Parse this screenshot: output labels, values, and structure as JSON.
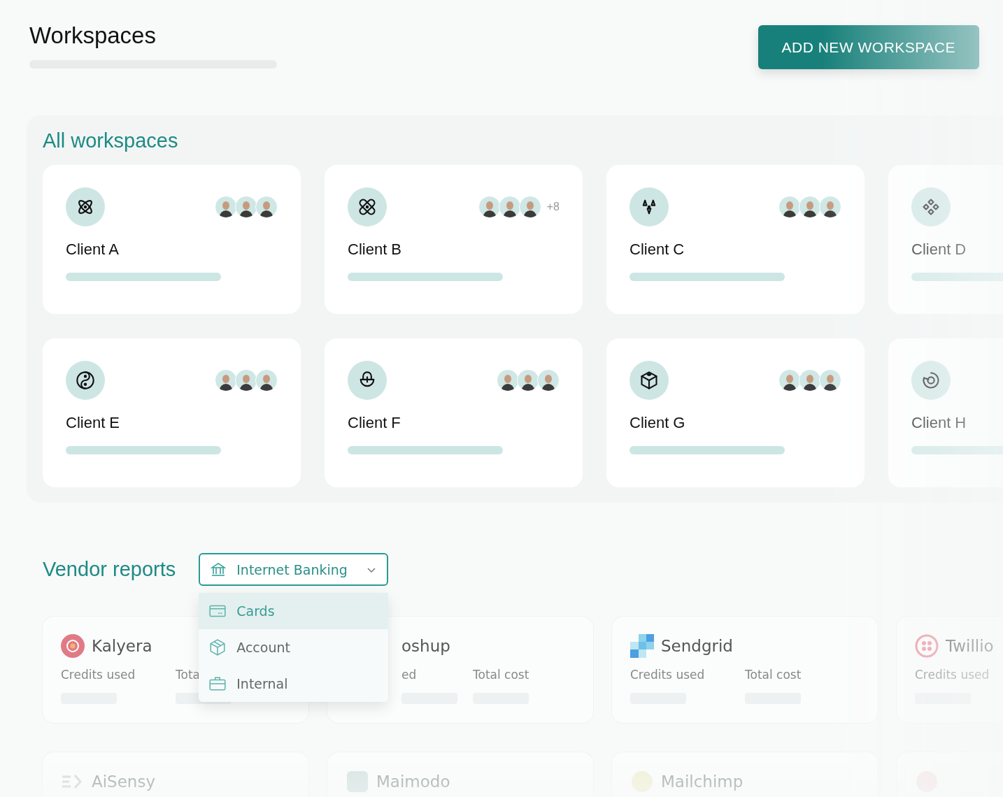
{
  "header": {
    "title": "Workspaces",
    "add_button": "ADD NEW WORKSPACE"
  },
  "workspaces": {
    "title": "All workspaces",
    "cards": [
      {
        "name": "Client A"
      },
      {
        "name": "Client B",
        "extra_members": "+8"
      },
      {
        "name": "Client C"
      },
      {
        "name": "Client D"
      },
      {
        "name": "Client E"
      },
      {
        "name": "Client F"
      },
      {
        "name": "Client G"
      },
      {
        "name": "Client H"
      }
    ]
  },
  "vendor_reports": {
    "title": "Vendor reports",
    "select": {
      "value": "Internet Banking",
      "expanded": true,
      "options": [
        {
          "label": "Cards",
          "selected": true
        },
        {
          "label": "Account",
          "selected": false
        },
        {
          "label": "Internal",
          "selected": false
        }
      ]
    },
    "vendors": [
      {
        "name": "Kalyera",
        "partly_hidden": false,
        "metrics": [
          "Credits used",
          "Tota"
        ]
      },
      {
        "name": "oshup",
        "partly_hidden": true,
        "metrics": [
          "ed",
          "Total cost"
        ]
      },
      {
        "name": "Sendgrid",
        "partly_hidden": false,
        "metrics": [
          "Credits used",
          "Total cost"
        ]
      },
      {
        "name": "Twillio",
        "partly_hidden": false,
        "metrics": [
          "Credits used"
        ]
      },
      {
        "name": "AiSensy",
        "partly_hidden": false
      },
      {
        "name": "Maimodo",
        "partly_hidden": false
      },
      {
        "name": "Mailchimp",
        "partly_hidden": false
      }
    ]
  }
}
